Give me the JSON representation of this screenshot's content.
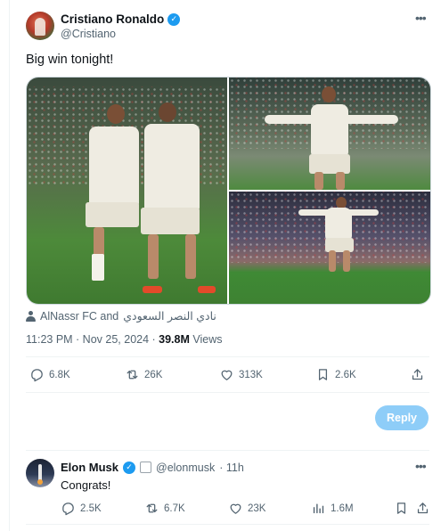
{
  "tweet": {
    "author_name": "Cristiano Ronaldo",
    "author_handle": "@Cristiano",
    "text": "Big win tonight!",
    "tagged_label_part1": "AlNassr FC and",
    "tagged_label_part2": "نادي النصر السعودي",
    "time_date": "11:23 PM · Nov 25, 2024 · ",
    "views_count": "39.8M",
    "views_label": " Views",
    "actions": {
      "replies": "6.8K",
      "reposts": "26K",
      "likes": "313K",
      "bookmarks": "2.6K"
    }
  },
  "reply_button": {
    "label": "Reply"
  },
  "reply_tweet": {
    "author_name": "Elon Musk",
    "author_handle": "@elonmusk",
    "time": "· 11h",
    "text": "Congrats!",
    "actions": {
      "replies": "2.5K",
      "reposts": "6.7K",
      "likes": "23K",
      "views": "1.6M"
    }
  },
  "colors": {
    "accent": "#1d9bf0",
    "reply_button_bg": "#8ecdf8",
    "secondary_text": "#536471"
  },
  "icons": [
    "verified-badge-icon",
    "more-icon",
    "person-icon",
    "reply-icon",
    "repost-icon",
    "like-icon",
    "bookmark-icon",
    "share-icon",
    "views-icon"
  ]
}
